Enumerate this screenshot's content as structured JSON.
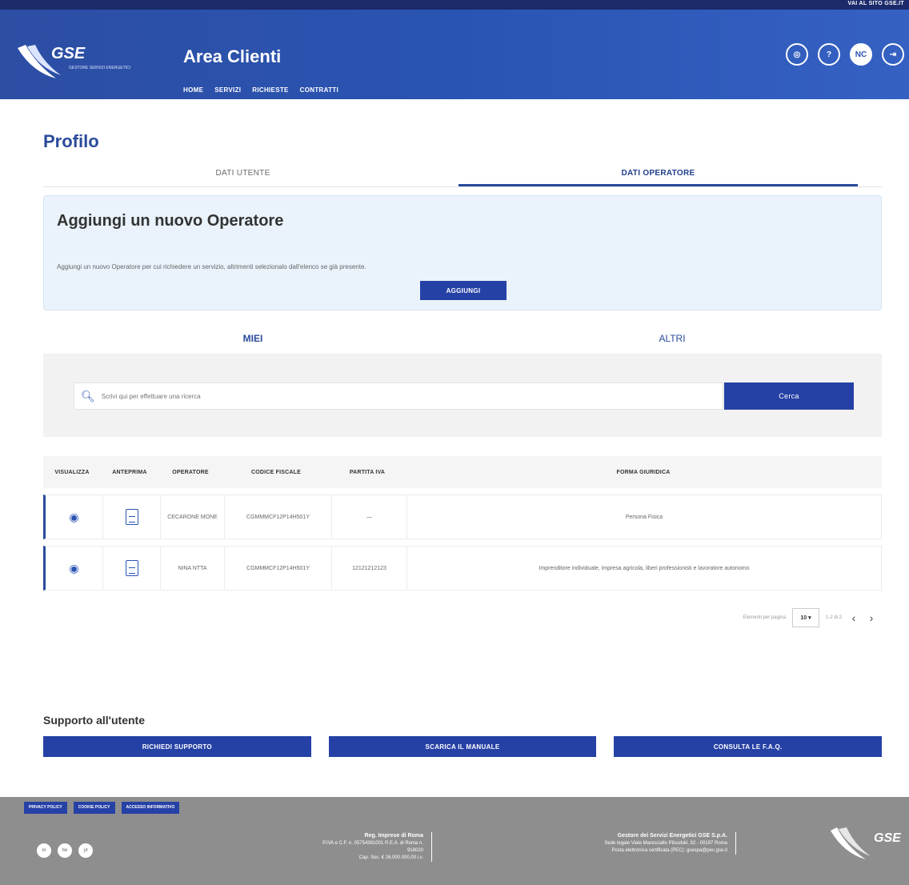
{
  "topbar": {
    "quick_link": "VAI AL SITO GSE.IT"
  },
  "header": {
    "logo_text": "GSE",
    "logo_sub": "GESTORE SERVIZI ENERGETICI",
    "title": "Area Clienti",
    "nav": [
      "HOME",
      "SERVIZI",
      "RICHIESTE",
      "CONTRATTI"
    ],
    "icons": [
      {
        "name": "user-icon",
        "glyph": "◎"
      },
      {
        "name": "chat-icon",
        "glyph": "?"
      },
      {
        "name": "profile-icon",
        "glyph": "NC"
      },
      {
        "name": "logout-icon",
        "glyph": "⇥"
      }
    ]
  },
  "page": {
    "title": "Profilo"
  },
  "tabs": {
    "utente": "DATI UTENTE",
    "operatore": "DATI OPERATORE"
  },
  "add_panel": {
    "title": "Aggiungi un nuovo Operatore",
    "description": "Aggiungi un nuovo Operatore per cui richiedere un servizio, altrimenti selezionalo dall'elenco se già presente.",
    "button": "AGGIUNGI"
  },
  "subtabs": {
    "miei": "MIEI",
    "altri": "ALTRI"
  },
  "search": {
    "placeholder": "Scrivi qui per effettuare una ricerca",
    "button": "Cerca"
  },
  "table": {
    "headers": [
      "VISUALIZZA",
      "ANTEPRIMA",
      "OPERATORE",
      "CODICE FISCALE",
      "PARTITA IVA",
      "FORMA GIURIDICA"
    ],
    "rows": [
      {
        "operatore": "CECARONE MONE",
        "codice_fiscale": "CGMMMCF12P14H501Y",
        "partita_iva": "—",
        "forma_giuridica": "Persona Fisica"
      },
      {
        "operatore": "NINA NTTA",
        "codice_fiscale": "CGMMMCF12P14H501Y",
        "partita_iva": "12121212123",
        "forma_giuridica": "Imprenditore individuale, impresa agricola, liberi professionisti e lavoratore autonomo"
      }
    ]
  },
  "pager": {
    "label": "Elementi per pagina",
    "per_page": "10 ▾",
    "range": "1-2 di 2",
    "prev": "‹",
    "next": "›"
  },
  "support": {
    "title": "Supporto all'utente",
    "buttons": [
      "RICHIEDI SUPPORTO",
      "SCARICA IL MANUALE",
      "CONSULTA LE F.A.Q."
    ]
  },
  "footer": {
    "links": [
      "PRIVACY POLICY",
      "COOKIE POLICY",
      "ACCESSO INFORMATIVO"
    ],
    "socials": [
      "in",
      "tw",
      "yt"
    ],
    "block1_title": "Reg. Imprese di Roma",
    "block1_lines": [
      "P.IVA e C.F. n. 05754381001 R.E.A. di Roma n.",
      "918020",
      "Cap. Soc. € 26.000.000,00 i.v."
    ],
    "block2_title": "Gestore dei Servizi Energetici GSE S.p.A.",
    "block2_lines": [
      "Sede legale Viale Maresciallo Pilsudski, 92 - 00197 Roma",
      "Posta elettronica certificata (PEC): gsespa@pec.gse.it"
    ],
    "logo_text": "GSE"
  }
}
